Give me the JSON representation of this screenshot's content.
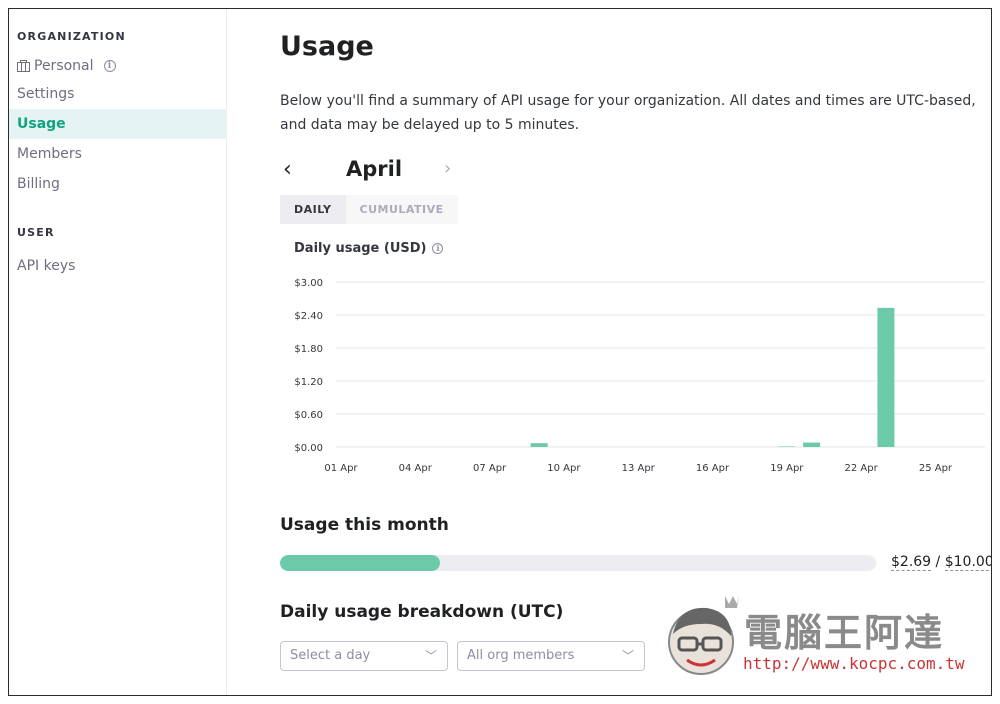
{
  "sidebar": {
    "org_section_title": "ORGANIZATION",
    "org_name": "Personal",
    "items": [
      {
        "label": "Settings"
      },
      {
        "label": "Usage"
      },
      {
        "label": "Members"
      },
      {
        "label": "Billing"
      }
    ],
    "user_section_title": "USER",
    "user_items": [
      {
        "label": "API keys"
      }
    ]
  },
  "main": {
    "title": "Usage",
    "description": "Below you'll find a summary of API usage for your organization. All dates and times are UTC-based, and data may be delayed up to 5 minutes.",
    "month": "April",
    "tabs": [
      {
        "label": "DAILY"
      },
      {
        "label": "CUMULATIVE"
      }
    ],
    "chart_title": "Daily usage (USD)",
    "usage_this_month_title": "Usage this month",
    "usage_current": "$2.69",
    "usage_separator": " / ",
    "usage_limit": "$10.00",
    "usage_fraction": 0.269,
    "breakdown_title": "Daily usage breakdown (UTC)",
    "day_select_placeholder": "Select a day",
    "members_select_value": "All org members"
  },
  "watermark": {
    "text": "電腦王阿達",
    "url": "http://www.kocpc.com.tw"
  },
  "colors": {
    "accent": "#10a37f",
    "bar": "#6ccaa9",
    "progress": "#6ccaa9"
  },
  "chart_data": {
    "type": "bar",
    "title": "Daily usage (USD)",
    "xlabel": "",
    "ylabel": "",
    "ylim": [
      0,
      3
    ],
    "y_ticks": [
      "$3.00",
      "$2.40",
      "$1.80",
      "$1.20",
      "$0.60",
      "$0.00"
    ],
    "x_tick_labels": [
      "01 Apr",
      "04 Apr",
      "07 Apr",
      "10 Apr",
      "13 Apr",
      "16 Apr",
      "19 Apr",
      "22 Apr",
      "25 Apr"
    ],
    "x_tick_days": [
      1,
      4,
      7,
      10,
      13,
      16,
      19,
      22,
      25
    ],
    "days": [
      1,
      2,
      3,
      4,
      5,
      6,
      7,
      8,
      9,
      10,
      11,
      12,
      13,
      14,
      15,
      16,
      17,
      18,
      19,
      20,
      21,
      22,
      23,
      24,
      25,
      26
    ],
    "values": [
      0,
      0,
      0,
      0,
      0,
      0,
      0,
      0,
      0.07,
      0,
      0,
      0,
      0,
      0,
      0,
      0,
      0,
      0,
      0.01,
      0.08,
      0,
      0,
      2.53,
      0,
      0,
      0
    ],
    "grid": true
  }
}
